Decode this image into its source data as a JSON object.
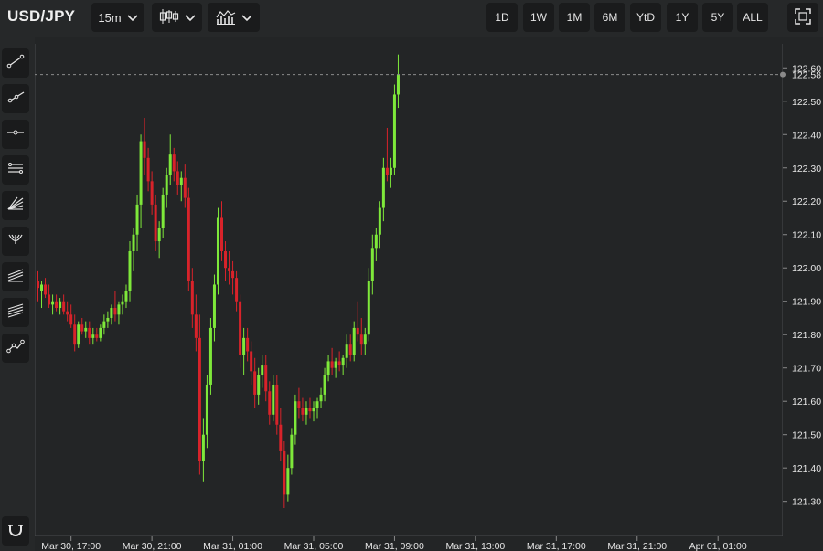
{
  "header": {
    "symbol": "USD/JPY",
    "interval": "15m",
    "chart_style_icon": "candlestick-icon",
    "indicators_icon": "indicators-icon",
    "ranges": [
      "1D",
      "1W",
      "1M",
      "6M",
      "YtD",
      "1Y",
      "5Y",
      "ALL"
    ],
    "fullscreen_icon": "fullscreen-icon"
  },
  "sidebar": {
    "tools": [
      "trend-line-icon",
      "ray-icon",
      "horizontal-line-icon",
      "parallel-channel-icon",
      "fan-icon",
      "pitchfork-icon",
      "regression-channel-icon",
      "multi-channel-icon",
      "polyline-icon"
    ],
    "bottom_tool": "magnet-icon"
  },
  "colors": {
    "up": "#7ee83a",
    "down": "#d8232a",
    "background": "#232526",
    "axis_text": "#e6e6e6",
    "last_price_line": "#8a8a8a"
  },
  "chart_data": {
    "type": "candlestick",
    "y_ticks": [
      "121.30",
      "121.40",
      "121.50",
      "121.60",
      "121.70",
      "121.80",
      "121.90",
      "122.00",
      "122.10",
      "122.20",
      "122.30",
      "122.40",
      "122.50",
      "122.60"
    ],
    "ylim": [
      121.195,
      122.672
    ],
    "last_price": "122.58",
    "x_ticks": [
      "Mar 30, 17:00",
      "Mar 30, 21:00",
      "Mar 31, 01:00",
      "Mar 31, 05:00",
      "Mar 31, 09:00",
      "Mar 31, 13:00",
      "Mar 31, 17:00",
      "Mar 31, 21:00",
      "Apr 01, 01:00"
    ],
    "x_tick_index": [
      9,
      31,
      53,
      75,
      97,
      119,
      141,
      163,
      185
    ],
    "ohlc": [
      [
        121.96,
        121.99,
        121.9,
        121.94
      ],
      [
        121.93,
        121.96,
        121.88,
        121.95
      ],
      [
        121.95,
        121.97,
        121.91,
        121.92
      ],
      [
        121.92,
        121.95,
        121.88,
        121.89
      ],
      [
        121.89,
        121.92,
        121.86,
        121.9
      ],
      [
        121.9,
        121.92,
        121.87,
        121.88
      ],
      [
        121.88,
        121.91,
        121.86,
        121.9
      ],
      [
        121.9,
        121.92,
        121.86,
        121.87
      ],
      [
        121.87,
        121.9,
        121.84,
        121.86
      ],
      [
        121.86,
        121.89,
        121.82,
        121.83
      ],
      [
        121.83,
        121.86,
        121.75,
        121.77
      ],
      [
        121.77,
        121.84,
        121.76,
        121.83
      ],
      [
        121.83,
        121.85,
        121.8,
        121.81
      ],
      [
        121.81,
        121.84,
        121.79,
        121.82
      ],
      [
        121.82,
        121.84,
        121.77,
        121.79
      ],
      [
        121.79,
        121.82,
        121.77,
        121.8
      ],
      [
        121.8,
        121.82,
        121.78,
        121.79
      ],
      [
        121.79,
        121.83,
        121.78,
        121.82
      ],
      [
        121.82,
        121.86,
        121.8,
        121.84
      ],
      [
        121.84,
        121.87,
        121.82,
        121.85
      ],
      [
        121.85,
        121.89,
        121.83,
        121.88
      ],
      [
        121.88,
        121.93,
        121.84,
        121.86
      ],
      [
        121.86,
        121.9,
        121.83,
        121.89
      ],
      [
        121.89,
        121.92,
        121.86,
        121.9
      ],
      [
        121.9,
        121.95,
        121.88,
        121.93
      ],
      [
        121.93,
        122.08,
        121.9,
        122.05
      ],
      [
        122.05,
        122.12,
        121.99,
        122.1
      ],
      [
        122.1,
        122.22,
        122.05,
        122.19
      ],
      [
        122.19,
        122.4,
        122.12,
        122.38
      ],
      [
        122.38,
        122.45,
        122.28,
        122.33
      ],
      [
        122.33,
        122.36,
        122.23,
        122.26
      ],
      [
        122.26,
        122.29,
        122.16,
        122.19
      ],
      [
        122.19,
        122.22,
        122.05,
        122.08
      ],
      [
        122.08,
        122.14,
        122.03,
        122.12
      ],
      [
        122.12,
        122.24,
        122.09,
        122.22
      ],
      [
        122.22,
        122.3,
        122.18,
        122.28
      ],
      [
        122.28,
        122.4,
        122.25,
        122.34
      ],
      [
        122.34,
        122.36,
        122.26,
        122.29
      ],
      [
        122.29,
        122.32,
        122.22,
        122.25
      ],
      [
        122.25,
        122.29,
        122.2,
        122.27
      ],
      [
        122.27,
        122.31,
        122.18,
        122.21
      ],
      [
        122.21,
        122.24,
        121.93,
        121.96
      ],
      [
        121.96,
        122.0,
        121.82,
        121.86
      ],
      [
        121.86,
        121.92,
        121.75,
        121.79
      ],
      [
        121.79,
        121.86,
        121.38,
        121.42
      ],
      [
        121.42,
        121.55,
        121.36,
        121.5
      ],
      [
        121.5,
        121.68,
        121.46,
        121.65
      ],
      [
        121.65,
        121.85,
        121.62,
        121.82
      ],
      [
        121.82,
        121.98,
        121.78,
        121.95
      ],
      [
        121.95,
        122.18,
        121.92,
        122.15
      ],
      [
        122.15,
        122.2,
        122.02,
        122.05
      ],
      [
        122.05,
        122.08,
        121.96,
        122.0
      ],
      [
        122.0,
        122.05,
        121.95,
        121.99
      ],
      [
        121.99,
        122.02,
        121.92,
        121.97
      ],
      [
        121.97,
        121.99,
        121.87,
        121.9
      ],
      [
        121.9,
        121.92,
        121.7,
        121.74
      ],
      [
        121.74,
        121.82,
        121.68,
        121.79
      ],
      [
        121.79,
        121.82,
        121.72,
        121.75
      ],
      [
        121.75,
        121.78,
        121.65,
        121.69
      ],
      [
        121.69,
        121.73,
        121.58,
        121.62
      ],
      [
        121.62,
        121.7,
        121.59,
        121.68
      ],
      [
        121.68,
        121.74,
        121.64,
        121.71
      ],
      [
        121.71,
        121.74,
        121.6,
        121.63
      ],
      [
        121.63,
        121.66,
        121.53,
        121.56
      ],
      [
        121.56,
        121.68,
        121.54,
        121.65
      ],
      [
        121.65,
        121.68,
        121.5,
        121.53
      ],
      [
        121.53,
        121.58,
        121.42,
        121.45
      ],
      [
        121.45,
        121.48,
        121.28,
        121.32
      ],
      [
        121.32,
        121.44,
        121.3,
        121.4
      ],
      [
        121.4,
        121.52,
        121.38,
        121.5
      ],
      [
        121.5,
        121.62,
        121.47,
        121.6
      ],
      [
        121.6,
        121.64,
        121.55,
        121.58
      ],
      [
        121.58,
        121.61,
        121.54,
        121.56
      ],
      [
        121.56,
        121.6,
        121.53,
        121.58
      ],
      [
        121.58,
        121.61,
        121.55,
        121.57
      ],
      [
        121.57,
        121.6,
        121.54,
        121.58
      ],
      [
        121.58,
        121.61,
        121.55,
        121.6
      ],
      [
        121.6,
        121.64,
        121.58,
        121.62
      ],
      [
        121.62,
        121.7,
        121.6,
        121.68
      ],
      [
        121.68,
        121.74,
        121.66,
        121.72
      ],
      [
        121.72,
        121.76,
        121.68,
        121.7
      ],
      [
        121.7,
        121.73,
        121.67,
        121.72
      ],
      [
        121.72,
        121.75,
        121.69,
        121.71
      ],
      [
        121.71,
        121.74,
        121.68,
        121.73
      ],
      [
        121.73,
        121.8,
        121.7,
        121.77
      ],
      [
        121.77,
        121.8,
        121.72,
        121.74
      ],
      [
        121.74,
        121.84,
        121.72,
        121.82
      ],
      [
        121.82,
        121.9,
        121.78,
        121.8
      ],
      [
        121.8,
        121.85,
        121.74,
        121.77
      ],
      [
        121.77,
        121.82,
        121.74,
        121.8
      ],
      [
        121.8,
        122.0,
        121.78,
        121.96
      ],
      [
        121.96,
        122.1,
        121.92,
        122.06
      ],
      [
        122.06,
        122.12,
        122.02,
        122.1
      ],
      [
        122.1,
        122.2,
        122.06,
        122.18
      ],
      [
        122.18,
        122.33,
        122.14,
        122.3
      ],
      [
        122.3,
        122.42,
        122.26,
        122.28
      ],
      [
        122.28,
        122.33,
        122.24,
        122.3
      ],
      [
        122.3,
        122.55,
        122.28,
        122.52
      ],
      [
        122.52,
        122.64,
        122.48,
        122.58
      ]
    ]
  }
}
